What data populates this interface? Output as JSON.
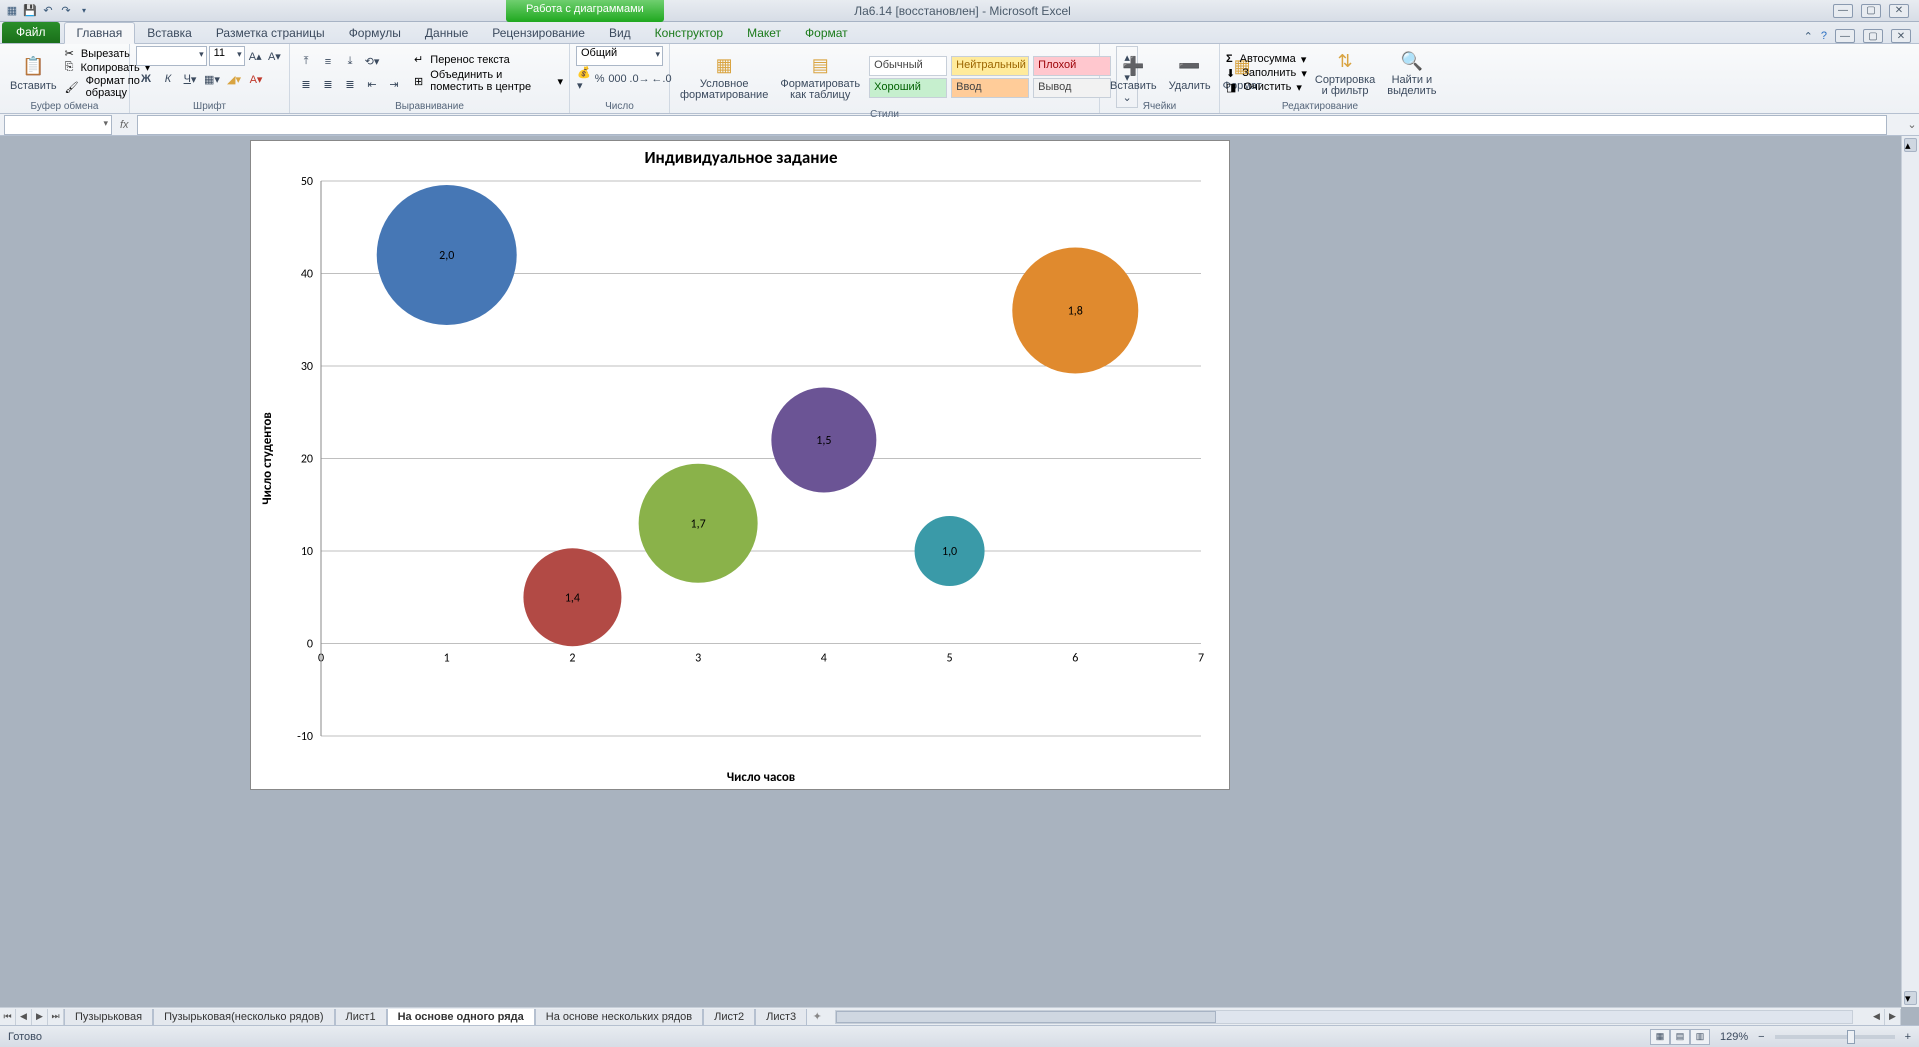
{
  "titlebar": {
    "doc_title": "Ла6.14 [восстановлен] - Microsoft Excel",
    "context_tab": "Работа с диаграммами"
  },
  "ribbon_tabs": {
    "file": "Файл",
    "tabs": [
      "Главная",
      "Вставка",
      "Разметка страницы",
      "Формулы",
      "Данные",
      "Рецензирование",
      "Вид",
      "Конструктор",
      "Макет",
      "Формат"
    ],
    "active": "Главная"
  },
  "clipboard": {
    "paste": "Вставить",
    "cut": "Вырезать",
    "copy": "Копировать",
    "painter": "Формат по образцу",
    "group": "Буфер обмена"
  },
  "font": {
    "group": "Шрифт",
    "size": "11"
  },
  "alignment": {
    "group": "Выравнивание",
    "wrap": "Перенос текста",
    "merge": "Объединить и поместить в центре"
  },
  "number": {
    "group": "Число",
    "format": "Общий"
  },
  "styles": {
    "group": "Стили",
    "cond": "Условное\nформатирование",
    "astable": "Форматировать\nкак таблицу",
    "normal": "Обычный",
    "neutral": "Нейтральный",
    "bad": "Плохой",
    "good": "Хороший",
    "input": "Ввод",
    "output": "Вывод"
  },
  "cells": {
    "group": "Ячейки",
    "insert": "Вставить",
    "delete": "Удалить",
    "format": "Формат"
  },
  "editing": {
    "group": "Редактирование",
    "sum": "Автосумма",
    "fill": "Заполнить",
    "clear": "Очистить",
    "sort": "Сортировка\nи фильтр",
    "find": "Найти и\nвыделить"
  },
  "formula_bar": {
    "name": "",
    "fx": "fx",
    "value": ""
  },
  "sheets": {
    "nav": [
      "⏮",
      "◀",
      "▶",
      "⏭"
    ],
    "tabs": [
      "Пузырьковая",
      "Пузырьковая(несколько рядов)",
      "Лист1",
      "На основе одного ряда",
      "На основе нескольких рядов",
      "Лист2",
      "Лист3"
    ],
    "active": "На основе одного ряда"
  },
  "statusbar": {
    "ready": "Готово",
    "zoom": "129%"
  },
  "chart_data": {
    "type": "bubble",
    "title": "Индивидуальное задание",
    "xlabel": "Число часов",
    "ylabel": "Число студентов",
    "xlim": [
      0,
      7
    ],
    "ylim": [
      -10,
      50
    ],
    "xticks": [
      0,
      1,
      2,
      3,
      4,
      5,
      6,
      7
    ],
    "yticks": [
      -10,
      0,
      10,
      20,
      30,
      40,
      50
    ],
    "points": [
      {
        "x": 1,
        "y": 42,
        "size": 2.0,
        "label": "2,0",
        "color": "#4677b5"
      },
      {
        "x": 2,
        "y": 5,
        "size": 1.4,
        "label": "1,4",
        "color": "#b24a45"
      },
      {
        "x": 3,
        "y": 13,
        "size": 1.7,
        "label": "1,7",
        "color": "#8ab24a"
      },
      {
        "x": 4,
        "y": 22,
        "size": 1.5,
        "label": "1,5",
        "color": "#6b5495"
      },
      {
        "x": 5,
        "y": 10,
        "size": 1.0,
        "label": "1,0",
        "color": "#3a9aa8"
      },
      {
        "x": 6,
        "y": 36,
        "size": 1.8,
        "label": "1,8",
        "color": "#e08a2e"
      }
    ]
  }
}
